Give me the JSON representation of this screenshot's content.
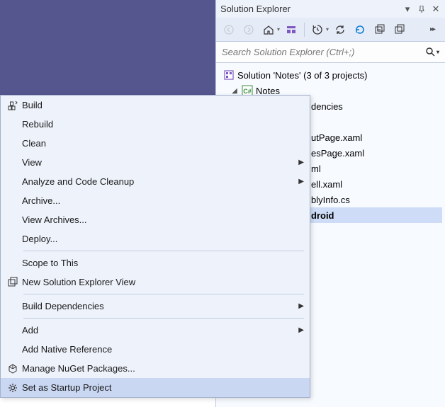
{
  "panel": {
    "title": "Solution Explorer",
    "search_placeholder": "Search Solution Explorer (Ctrl+;)"
  },
  "tree": {
    "solution": "Solution 'Notes' (3 of 3 projects)",
    "project": "Notes",
    "items": [
      "dencies",
      "utPage.xaml",
      "esPage.xaml",
      "ml",
      "ell.xaml",
      "blyInfo.cs",
      "droid"
    ]
  },
  "menu": {
    "build": "Build",
    "rebuild": "Rebuild",
    "clean": "Clean",
    "view": "View",
    "analyze": "Analyze and Code Cleanup",
    "archive": "Archive...",
    "view_archives": "View Archives...",
    "deploy": "Deploy...",
    "scope": "Scope to This",
    "new_view": "New Solution Explorer View",
    "build_deps": "Build Dependencies",
    "add": "Add",
    "add_native": "Add Native Reference",
    "nuget": "Manage NuGet Packages...",
    "startup": "Set as Startup Project"
  }
}
